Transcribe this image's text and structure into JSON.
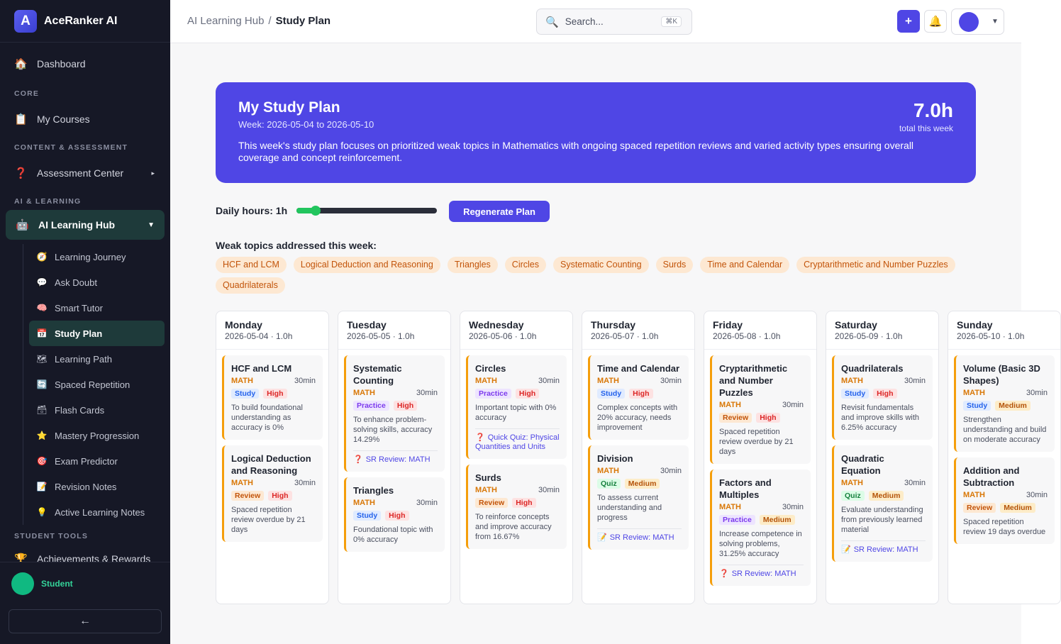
{
  "app": {
    "name": "AceRanker AI",
    "logo_letter": "A"
  },
  "sidebar": {
    "dashboard": "Dashboard",
    "sections": {
      "core": "CORE",
      "content": "CONTENT & ASSESSMENT",
      "ai": "AI & LEARNING",
      "student": "STUDENT TOOLS"
    },
    "my_courses": "My Courses",
    "assessment_center": "Assessment Center",
    "ai_hub": "AI Learning Hub",
    "sub_items": [
      {
        "label": "Learning Journey",
        "icon": "compass-icon",
        "glyph": "🧭"
      },
      {
        "label": "Ask Doubt",
        "icon": "chat-icon",
        "glyph": "💬"
      },
      {
        "label": "Smart Tutor",
        "icon": "brain-icon",
        "glyph": "🧠"
      },
      {
        "label": "Study Plan",
        "icon": "calendar-icon",
        "glyph": "📅"
      },
      {
        "label": "Learning Path",
        "icon": "map-icon",
        "glyph": "🗺"
      },
      {
        "label": "Spaced Repetition",
        "icon": "repeat-icon",
        "glyph": "🔄"
      },
      {
        "label": "Flash Cards",
        "icon": "card-icon",
        "glyph": "🗃"
      },
      {
        "label": "Mastery Progression",
        "icon": "star-icon",
        "glyph": "⭐"
      },
      {
        "label": "Exam Predictor",
        "icon": "target-icon",
        "glyph": "🎯"
      },
      {
        "label": "Revision Notes",
        "icon": "notes-icon",
        "glyph": "📝"
      },
      {
        "label": "Active Learning Notes",
        "icon": "bulb-icon",
        "glyph": "💡"
      }
    ],
    "achievements": "Achievements & Rewards",
    "student_name": "Student",
    "collapse": "←"
  },
  "topbar": {
    "crumb_parent": "AI Learning Hub",
    "crumb_sep": "/",
    "crumb_current": "Study Plan",
    "search_placeholder": "Search...",
    "search_shortcut": "⌘K",
    "plus": "+",
    "bell": "🔔",
    "user_caret": "▼"
  },
  "banner": {
    "title": "My Study Plan",
    "week": "Week: 2026-05-04 to 2026-05-10",
    "total_value": "7.0h",
    "total_label": "total this week",
    "summary": "This week's study plan focuses on prioritized weak topics in Mathematics with ongoing spaced repetition reviews and varied activity types ensuring overall coverage and concept reinforcement."
  },
  "controls": {
    "daily_hours_label": "Daily hours: 1h",
    "daily_hours_value": 1,
    "daily_hours_fraction": 0.1,
    "regenerate": "Regenerate Plan"
  },
  "weak": {
    "title": "Weak topics addressed this week:",
    "tags": [
      "HCF and LCM",
      "Logical Deduction and Reasoning",
      "Triangles",
      "Circles",
      "Systematic Counting",
      "Surds",
      "Time and Calendar",
      "Cryptarithmetic and Number Puzzles",
      "Quadrilaterals"
    ]
  },
  "days": [
    {
      "name": "Monday",
      "meta": "2026-05-04 · 1.0h",
      "tasks": [
        {
          "title": "HCF and LCM",
          "subject": "MATH",
          "duration": "30min",
          "type": "Study",
          "priority": "High",
          "desc": "To build foundational understanding as accuracy is 0%",
          "link": ""
        },
        {
          "title": "Logical Deduction and Reasoning",
          "subject": "MATH",
          "duration": "30min",
          "type": "Review",
          "priority": "High",
          "desc": "Spaced repetition review overdue by 21 days",
          "link": ""
        }
      ]
    },
    {
      "name": "Tuesday",
      "meta": "2026-05-05 · 1.0h",
      "tasks": [
        {
          "title": "Systematic Counting",
          "subject": "MATH",
          "duration": "30min",
          "type": "Practice",
          "priority": "High",
          "desc": "To enhance problem-solving skills, accuracy 14.29%",
          "link": "SR Review: MATH",
          "link_icon": "❓"
        },
        {
          "title": "Triangles",
          "subject": "MATH",
          "duration": "30min",
          "type": "Study",
          "priority": "High",
          "desc": "Foundational topic with 0% accuracy",
          "link": ""
        }
      ]
    },
    {
      "name": "Wednesday",
      "meta": "2026-05-06 · 1.0h",
      "tasks": [
        {
          "title": "Circles",
          "subject": "MATH",
          "duration": "30min",
          "type": "Practice",
          "priority": "High",
          "desc": "Important topic with 0% accuracy",
          "link": "Quick Quiz: Physical Quantities and Units",
          "link_icon": "❓"
        },
        {
          "title": "Surds",
          "subject": "MATH",
          "duration": "30min",
          "type": "Review",
          "priority": "High",
          "desc": "To reinforce concepts and improve accuracy from 16.67%",
          "link": ""
        }
      ]
    },
    {
      "name": "Thursday",
      "meta": "2026-05-07 · 1.0h",
      "tasks": [
        {
          "title": "Time and Calendar",
          "subject": "MATH",
          "duration": "30min",
          "type": "Study",
          "priority": "High",
          "desc": "Complex concepts with 20% accuracy, needs improvement",
          "link": ""
        },
        {
          "title": "Division",
          "subject": "MATH",
          "duration": "30min",
          "type": "Quiz",
          "priority": "Medium",
          "desc": "To assess current understanding and progress",
          "link": "SR Review: MATH",
          "link_icon": "📝"
        }
      ]
    },
    {
      "name": "Friday",
      "meta": "2026-05-08 · 1.0h",
      "tasks": [
        {
          "title": "Cryptarithmetic and Number Puzzles",
          "subject": "MATH",
          "duration": "30min",
          "type": "Review",
          "priority": "High",
          "desc": "Spaced repetition review overdue by 21 days",
          "link": ""
        },
        {
          "title": "Factors and Multiples",
          "subject": "MATH",
          "duration": "30min",
          "type": "Practice",
          "priority": "Medium",
          "desc": "Increase competence in solving problems, 31.25% accuracy",
          "link": "SR Review: MATH",
          "link_icon": "❓"
        }
      ]
    },
    {
      "name": "Saturday",
      "meta": "2026-05-09 · 1.0h",
      "tasks": [
        {
          "title": "Quadrilaterals",
          "subject": "MATH",
          "duration": "30min",
          "type": "Study",
          "priority": "High",
          "desc": "Revisit fundamentals and improve skills with 6.25% accuracy",
          "link": ""
        },
        {
          "title": "Quadratic Equation",
          "subject": "MATH",
          "duration": "30min",
          "type": "Quiz",
          "priority": "Medium",
          "desc": "Evaluate understanding from previously learned material",
          "link": "SR Review: MATH",
          "link_icon": "📝"
        }
      ]
    },
    {
      "name": "Sunday",
      "meta": "2026-05-10 · 1.0h",
      "tasks": [
        {
          "title": "Volume (Basic 3D Shapes)",
          "subject": "MATH",
          "duration": "30min",
          "type": "Study",
          "priority": "Medium",
          "desc": "Strengthen understanding and build on moderate accuracy",
          "link": ""
        },
        {
          "title": "Addition and Subtraction",
          "subject": "MATH",
          "duration": "30min",
          "type": "Review",
          "priority": "Medium",
          "desc": "Spaced repetition review 19 days overdue",
          "link": ""
        }
      ]
    }
  ],
  "colors": {
    "accent": "#4f46e5",
    "sidebar": "#161826",
    "active": "#1e3a3a",
    "task_border": "#f59e0b"
  }
}
